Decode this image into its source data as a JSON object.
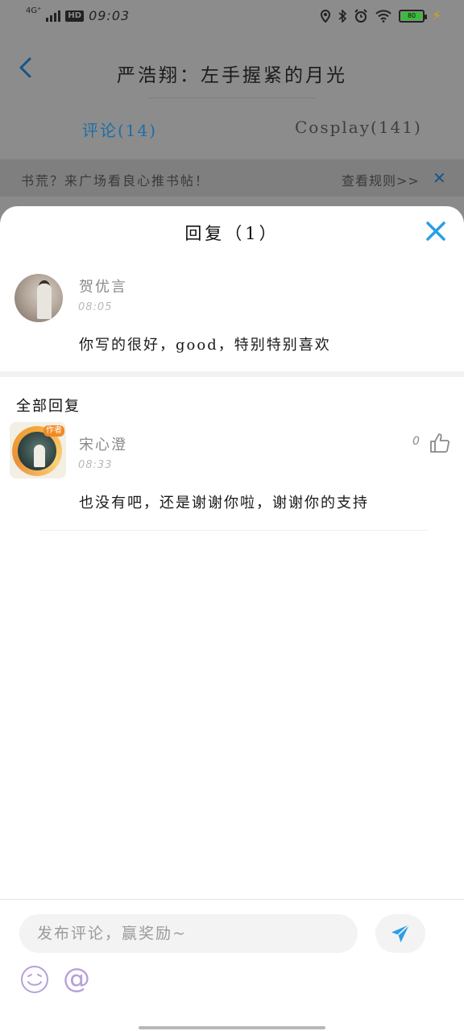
{
  "status_bar": {
    "network_type": "4G⁺",
    "hd_badge": "HD",
    "time": "09:03",
    "battery_level": "80",
    "icons": [
      "location-icon",
      "bluetooth-icon",
      "alarm-icon",
      "wifi-icon",
      "battery-icon",
      "charging-icon"
    ]
  },
  "header": {
    "back_icon": "chevron-left-icon",
    "title": "严浩翔：左手握紧的月光"
  },
  "tabs": [
    {
      "label": "评论(14)",
      "active": true
    },
    {
      "label": "Cosplay(141)",
      "active": false
    }
  ],
  "notice": {
    "text": "书荒？来广场看良心推书帖！",
    "rules_link": "查看规则>>",
    "close_icon": "close-icon"
  },
  "sheet": {
    "title": "回复（1）",
    "close_icon": "close-icon",
    "original_comment": {
      "author": "贺优言",
      "time": "08:05",
      "content": "你写的很好，good，特别特别喜欢"
    },
    "section_label": "全部回复",
    "replies": [
      {
        "author": "宋心澄",
        "time": "08:33",
        "content": "也没有吧，还是谢谢你啦，谢谢你的支持",
        "likes": "0",
        "avatar_tag": "作者"
      }
    ]
  },
  "input_bar": {
    "placeholder": "发布评论，赢奖励~",
    "send_icon": "send-icon",
    "emoji_icon": "emoji-icon",
    "mention_label": "@"
  },
  "colors": {
    "accent": "#2a9ee6",
    "tab_active": "#1b6fa8",
    "mention_purple": "#b69fdc"
  }
}
